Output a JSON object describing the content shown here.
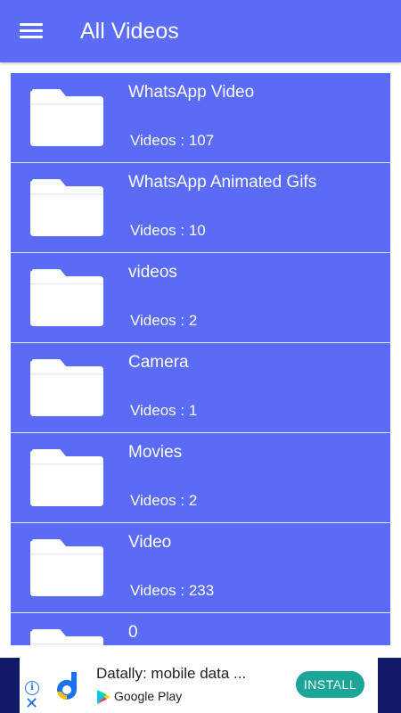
{
  "header": {
    "title": "All Videos",
    "menu_icon": "hamburger-menu-icon",
    "background": "#5b6cf7"
  },
  "folders": [
    {
      "name": "WhatsApp Video",
      "count": "Videos : 107"
    },
    {
      "name": "WhatsApp Animated Gifs",
      "count": "Videos : 10"
    },
    {
      "name": "videos",
      "count": "Videos : 2"
    },
    {
      "name": "Camera",
      "count": "Videos : 1"
    },
    {
      "name": "Movies",
      "count": "Videos : 2"
    },
    {
      "name": "Video",
      "count": "Videos : 233"
    },
    {
      "name": "0",
      "count": ""
    }
  ],
  "folder_icon": "folder-icon",
  "row_color": "#5a6cf6",
  "ad": {
    "title": "Datally: mobile data ...",
    "store": "Google Play",
    "install_label": "INSTALL",
    "install_color": "#1ca69a",
    "bar_color": "#111a66"
  }
}
